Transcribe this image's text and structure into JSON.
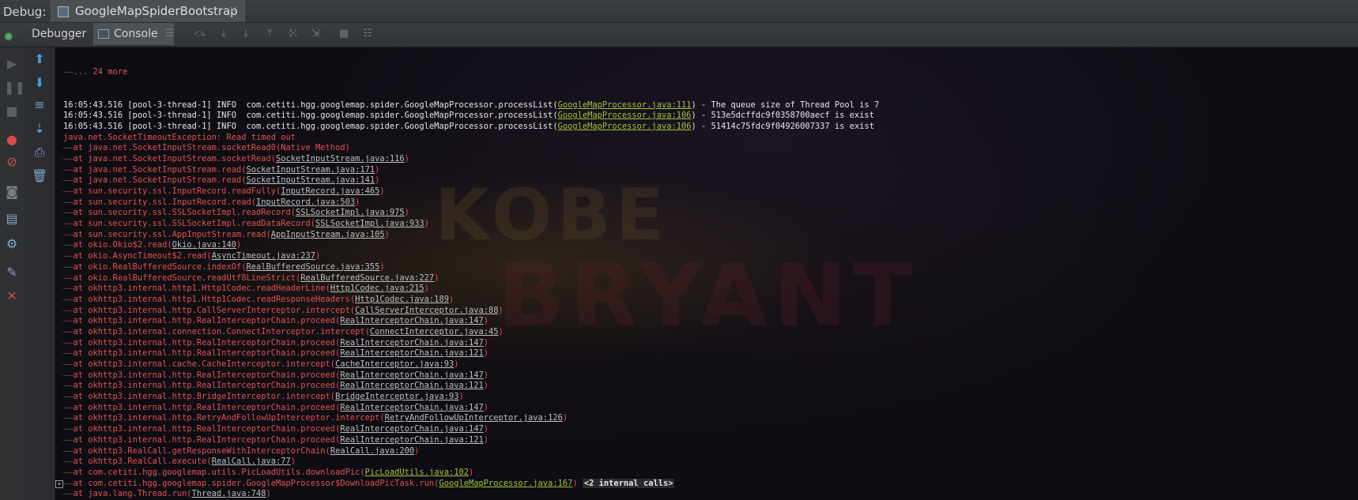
{
  "window": {
    "debug_label": "Debug:",
    "tab_title": "GoogleMapSpiderBootstrap",
    "tab_close": "×"
  },
  "toolbar": {
    "debugger_label": "Debugger",
    "console_label": "Console",
    "console_pin": "→*"
  },
  "colors": {
    "error": "#e0524f",
    "info": "#e6e6e6",
    "link_green": "#a3c43a",
    "link_gray": "#bfbfbf"
  },
  "console": {
    "more": "... 24 more",
    "info_lines": [
      {
        "pre": "16:05:43.516 [pool-3-thread-1] INFO  com.cetiti.hgg.googlemap.spider.GoogleMapProcessor.processList(",
        "link": "GoogleMapProcessor.java:111",
        "post": ") - The queue size of Thread Pool is 7"
      },
      {
        "pre": "16:05:43.516 [pool-3-thread-1] INFO  com.cetiti.hgg.googlemap.spider.GoogleMapProcessor.processList(",
        "link": "GoogleMapProcessor.java:106",
        "post": ") - 513e5dcffdc9f0358700aecf is exist"
      },
      {
        "pre": "16:05:43.516 [pool-3-thread-1] INFO  com.cetiti.hgg.googlemap.spider.GoogleMapProcessor.processList(",
        "link": "GoogleMapProcessor.java:106",
        "post": ") - 51414c75fdc9f04926007337 is exist"
      }
    ],
    "exception": "java.net.SocketTimeoutException: Read timed out",
    "stack": [
      {
        "pre": "at java.net.SocketInputStream.socketRead0(Native Method)",
        "link": "",
        "post": ""
      },
      {
        "pre": "at java.net.SocketInputStream.socketRead(",
        "link": "SocketInputStream.java:116",
        "post": ")"
      },
      {
        "pre": "at java.net.SocketInputStream.read(",
        "link": "SocketInputStream.java:171",
        "post": ")"
      },
      {
        "pre": "at java.net.SocketInputStream.read(",
        "link": "SocketInputStream.java:141",
        "post": ")"
      },
      {
        "pre": "at sun.security.ssl.InputRecord.readFully(",
        "link": "InputRecord.java:465",
        "post": ")"
      },
      {
        "pre": "at sun.security.ssl.InputRecord.read(",
        "link": "InputRecord.java:503",
        "post": ")"
      },
      {
        "pre": "at sun.security.ssl.SSLSocketImpl.readRecord(",
        "link": "SSLSocketImpl.java:975",
        "post": ")"
      },
      {
        "pre": "at sun.security.ssl.SSLSocketImpl.readDataRecord(",
        "link": "SSLSocketImpl.java:933",
        "post": ")"
      },
      {
        "pre": "at sun.security.ssl.AppInputStream.read(",
        "link": "AppInputStream.java:105",
        "post": ")"
      },
      {
        "pre": "at okio.Okio$2.read(",
        "link": "Okio.java:140",
        "post": ")"
      },
      {
        "pre": "at okio.AsyncTimeout$2.read(",
        "link": "AsyncTimeout.java:237",
        "post": ")"
      },
      {
        "pre": "at okio.RealBufferedSource.indexOf(",
        "link": "RealBufferedSource.java:355",
        "post": ")"
      },
      {
        "pre": "at okio.RealBufferedSource.readUtf8LineStrict(",
        "link": "RealBufferedSource.java:227",
        "post": ")"
      },
      {
        "pre": "at okhttp3.internal.http1.Http1Codec.readHeaderLine(",
        "link": "Http1Codec.java:215",
        "post": ")"
      },
      {
        "pre": "at okhttp3.internal.http1.Http1Codec.readResponseHeaders(",
        "link": "Http1Codec.java:189",
        "post": ")"
      },
      {
        "pre": "at okhttp3.internal.http.CallServerInterceptor.intercept(",
        "link": "CallServerInterceptor.java:88",
        "post": ")"
      },
      {
        "pre": "at okhttp3.internal.http.RealInterceptorChain.proceed(",
        "link": "RealInterceptorChain.java:147",
        "post": ")"
      },
      {
        "pre": "at okhttp3.internal.connection.ConnectInterceptor.intercept(",
        "link": "ConnectInterceptor.java:45",
        "post": ")"
      },
      {
        "pre": "at okhttp3.internal.http.RealInterceptorChain.proceed(",
        "link": "RealInterceptorChain.java:147",
        "post": ")"
      },
      {
        "pre": "at okhttp3.internal.http.RealInterceptorChain.proceed(",
        "link": "RealInterceptorChain.java:121",
        "post": ")"
      },
      {
        "pre": "at okhttp3.internal.cache.CacheInterceptor.intercept(",
        "link": "CacheInterceptor.java:93",
        "post": ")"
      },
      {
        "pre": "at okhttp3.internal.http.RealInterceptorChain.proceed(",
        "link": "RealInterceptorChain.java:147",
        "post": ")"
      },
      {
        "pre": "at okhttp3.internal.http.RealInterceptorChain.proceed(",
        "link": "RealInterceptorChain.java:121",
        "post": ")"
      },
      {
        "pre": "at okhttp3.internal.http.BridgeInterceptor.intercept(",
        "link": "BridgeInterceptor.java:93",
        "post": ")"
      },
      {
        "pre": "at okhttp3.internal.http.RealInterceptorChain.proceed(",
        "link": "RealInterceptorChain.java:147",
        "post": ")"
      },
      {
        "pre": "at okhttp3.internal.http.RetryAndFollowUpInterceptor.intercept(",
        "link": "RetryAndFollowUpInterceptor.java:126",
        "post": ")"
      },
      {
        "pre": "at okhttp3.internal.http.RealInterceptorChain.proceed(",
        "link": "RealInterceptorChain.java:147",
        "post": ")"
      },
      {
        "pre": "at okhttp3.internal.http.RealInterceptorChain.proceed(",
        "link": "RealInterceptorChain.java:121",
        "post": ")"
      },
      {
        "pre": "at okhttp3.RealCall.getResponseWithInterceptorChain(",
        "link": "RealCall.java:200",
        "post": ")"
      },
      {
        "pre": "at okhttp3.RealCall.execute(",
        "link": "RealCall.java:77",
        "post": ")"
      },
      {
        "pre": "at com.cetiti.hgg.googlemap.utils.PicLoadUtils.downloadPic(",
        "link": "PicLoadUtils.java:102",
        "post": ")",
        "green": true
      },
      {
        "pre": "at com.cetiti.hgg.googlemap.spider.GoogleMapProcessor$DownloadPicTask.run(",
        "link": "GoogleMapProcessor.java:167",
        "post": ")",
        "green": true,
        "expander": true,
        "internal": "<2 internal calls>"
      },
      {
        "pre": "at java.lang.Thread.run(",
        "link": "Thread.java:748",
        "post": ")"
      }
    ]
  }
}
